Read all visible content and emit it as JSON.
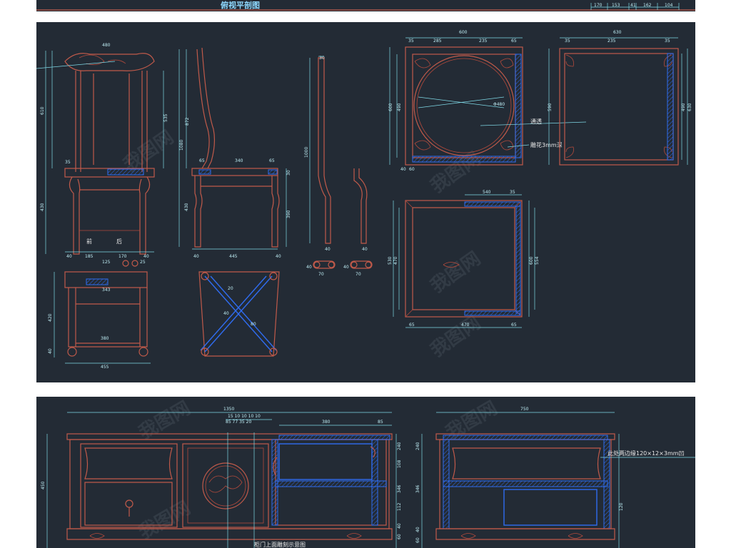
{
  "section_top": {
    "caption": "俯视平剖图",
    "dims": [
      "170",
      "153",
      "41",
      "162",
      "104"
    ]
  },
  "chair": {
    "front_view": {
      "top": "480",
      "seat_height": "430",
      "height_upper": "610",
      "height_upper_right": "535",
      "bottom_left": "40",
      "bottom_mid": "185",
      "bottom_mid2": "170",
      "bottom_right": "40",
      "label_front": "前",
      "label_back": "后",
      "side_35": "35"
    },
    "side_view": {
      "total": "1080",
      "upper": "872",
      "lower": "430",
      "seat": "340",
      "t65": "65",
      "b40": "40",
      "b445": "445",
      "b40r": "40",
      "h30": "30",
      "h390": "390"
    },
    "back_detail": {
      "top": "30",
      "height": "1000",
      "b40": "40"
    },
    "plan_view": {
      "w455": "455",
      "w380": "380",
      "w343": "343",
      "h420": "420",
      "h40": "40",
      "t125": "125",
      "t25": "25"
    },
    "seat_frame": {
      "d20": "20",
      "d40": "40",
      "d80": "80"
    },
    "small_parts": {
      "a": "40",
      "b": "70",
      "c": "40",
      "d": "70"
    }
  },
  "panel_door": {
    "top": "600",
    "top_segs": [
      "35",
      "285",
      "235",
      "65"
    ],
    "left": "490",
    "left_total": "600",
    "circle_label": "Φ480",
    "note_through": "通透",
    "note_carve": "雕花3mm深",
    "bot_left": "40",
    "bot_mid": "60"
  },
  "panel_frame": {
    "top": "630",
    "top_segs": [
      "35",
      "235",
      "35"
    ],
    "left": "590",
    "right": "630",
    "right2": "490"
  },
  "panel_board": {
    "top": "540",
    "top_r": "35",
    "left": "470",
    "left_total": "530",
    "right": "554",
    "right_total": "600",
    "bottom": "470",
    "bottom_l": "65",
    "bottom_r": "65"
  },
  "cabinet": {
    "width": "1350",
    "sub_dims": "15 10 10 10 10",
    "sub_dims2": "85 77 35 20",
    "w380": "380",
    "w85": "85",
    "height": "450",
    "h_sub": [
      "240",
      "108",
      "346",
      "112",
      "40",
      "60"
    ],
    "bottom_note": "柜门上面雕刻示意图"
  },
  "cabinet_side": {
    "width": "750",
    "note": "此处两边缘120×12×3mm凹",
    "h_dims": [
      "240",
      "346",
      "40",
      "60",
      "120"
    ]
  },
  "watermark": "我图网"
}
